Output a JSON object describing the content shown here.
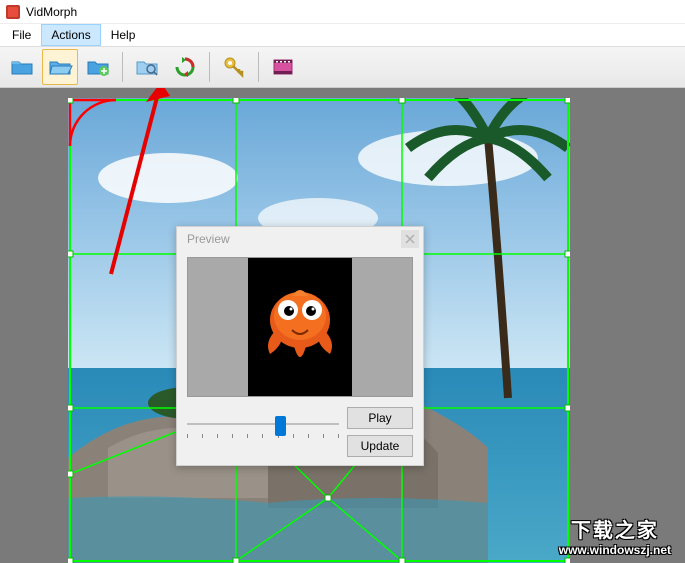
{
  "app": {
    "title": "VidMorph"
  },
  "menu": {
    "file": "File",
    "actions": "Actions",
    "help": "Help"
  },
  "toolbar": {
    "icons": [
      "folder-blue-1",
      "folder-blue-2",
      "folder-blue-3",
      "folder-search",
      "refresh",
      "key",
      "film"
    ]
  },
  "preview": {
    "title": "Preview",
    "play_label": "Play",
    "update_label": "Update",
    "slider_pos_percent": 58
  },
  "watermark": {
    "line1": "下载之家",
    "line2": "www.windowszj.net"
  },
  "colors": {
    "grid": "#00ff00",
    "arc": "#ff0000",
    "arrow": "#e60000",
    "canvas_bg": "#7a7a7a",
    "slider_thumb": "#0078d7"
  }
}
